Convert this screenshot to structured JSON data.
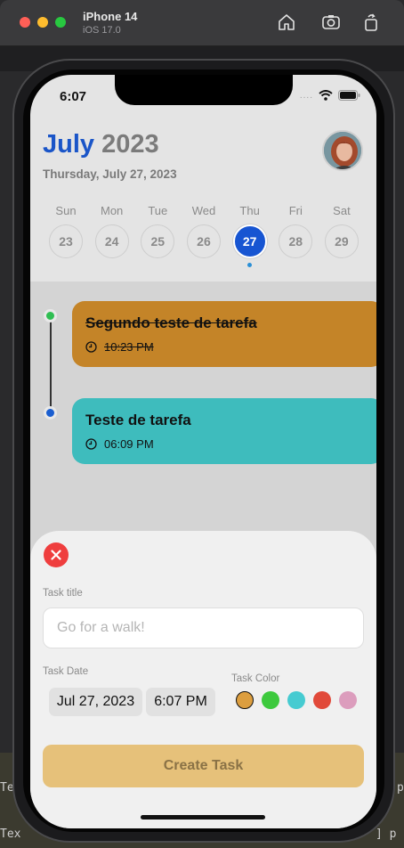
{
  "simulator": {
    "device_name": "iPhone 14",
    "os_version": "iOS 17.0",
    "icons": [
      "home-icon",
      "screenshot-icon",
      "rotate-icon"
    ]
  },
  "background": {
    "code_left": "Te",
    "code_left2": "Tex",
    "code_right": "p",
    "code_right2": "] p"
  },
  "status_bar": {
    "time": "6:07",
    "signal": "....",
    "icons": [
      "wifi-icon",
      "battery-icon"
    ]
  },
  "header": {
    "month": "July",
    "year": "2023",
    "full_date": "Thursday, July 27, 2023"
  },
  "week": {
    "days": [
      {
        "name": "Sun",
        "number": "23"
      },
      {
        "name": "Mon",
        "number": "24"
      },
      {
        "name": "Tue",
        "number": "25"
      },
      {
        "name": "Wed",
        "number": "26"
      },
      {
        "name": "Thu",
        "number": "27"
      },
      {
        "name": "Fri",
        "number": "28"
      },
      {
        "name": "Sat",
        "number": "29"
      }
    ],
    "selected_index": 4
  },
  "tasks": [
    {
      "title": "Segundo teste de tarefa",
      "time": "10:23 PM",
      "completed": true,
      "color": "#c48428",
      "dot_color": "#2fbe52"
    },
    {
      "title": "Teste de tarefa",
      "time": "06:09 PM",
      "completed": false,
      "color": "#3ebcbd",
      "dot_color": "#1a5ed0"
    }
  ],
  "sheet": {
    "task_title_label": "Task title",
    "task_title_placeholder": "Go for a walk!",
    "task_title_value": "",
    "task_date_label": "Task Date",
    "date_value": "Jul 27, 2023",
    "time_value": "6:07 PM",
    "task_color_label": "Task Color",
    "colors": [
      "#dc9e3f",
      "#3dc93d",
      "#46cbd1",
      "#e14a3a",
      "#dc9dbd"
    ],
    "selected_color_index": 0,
    "create_button": "Create Task"
  }
}
